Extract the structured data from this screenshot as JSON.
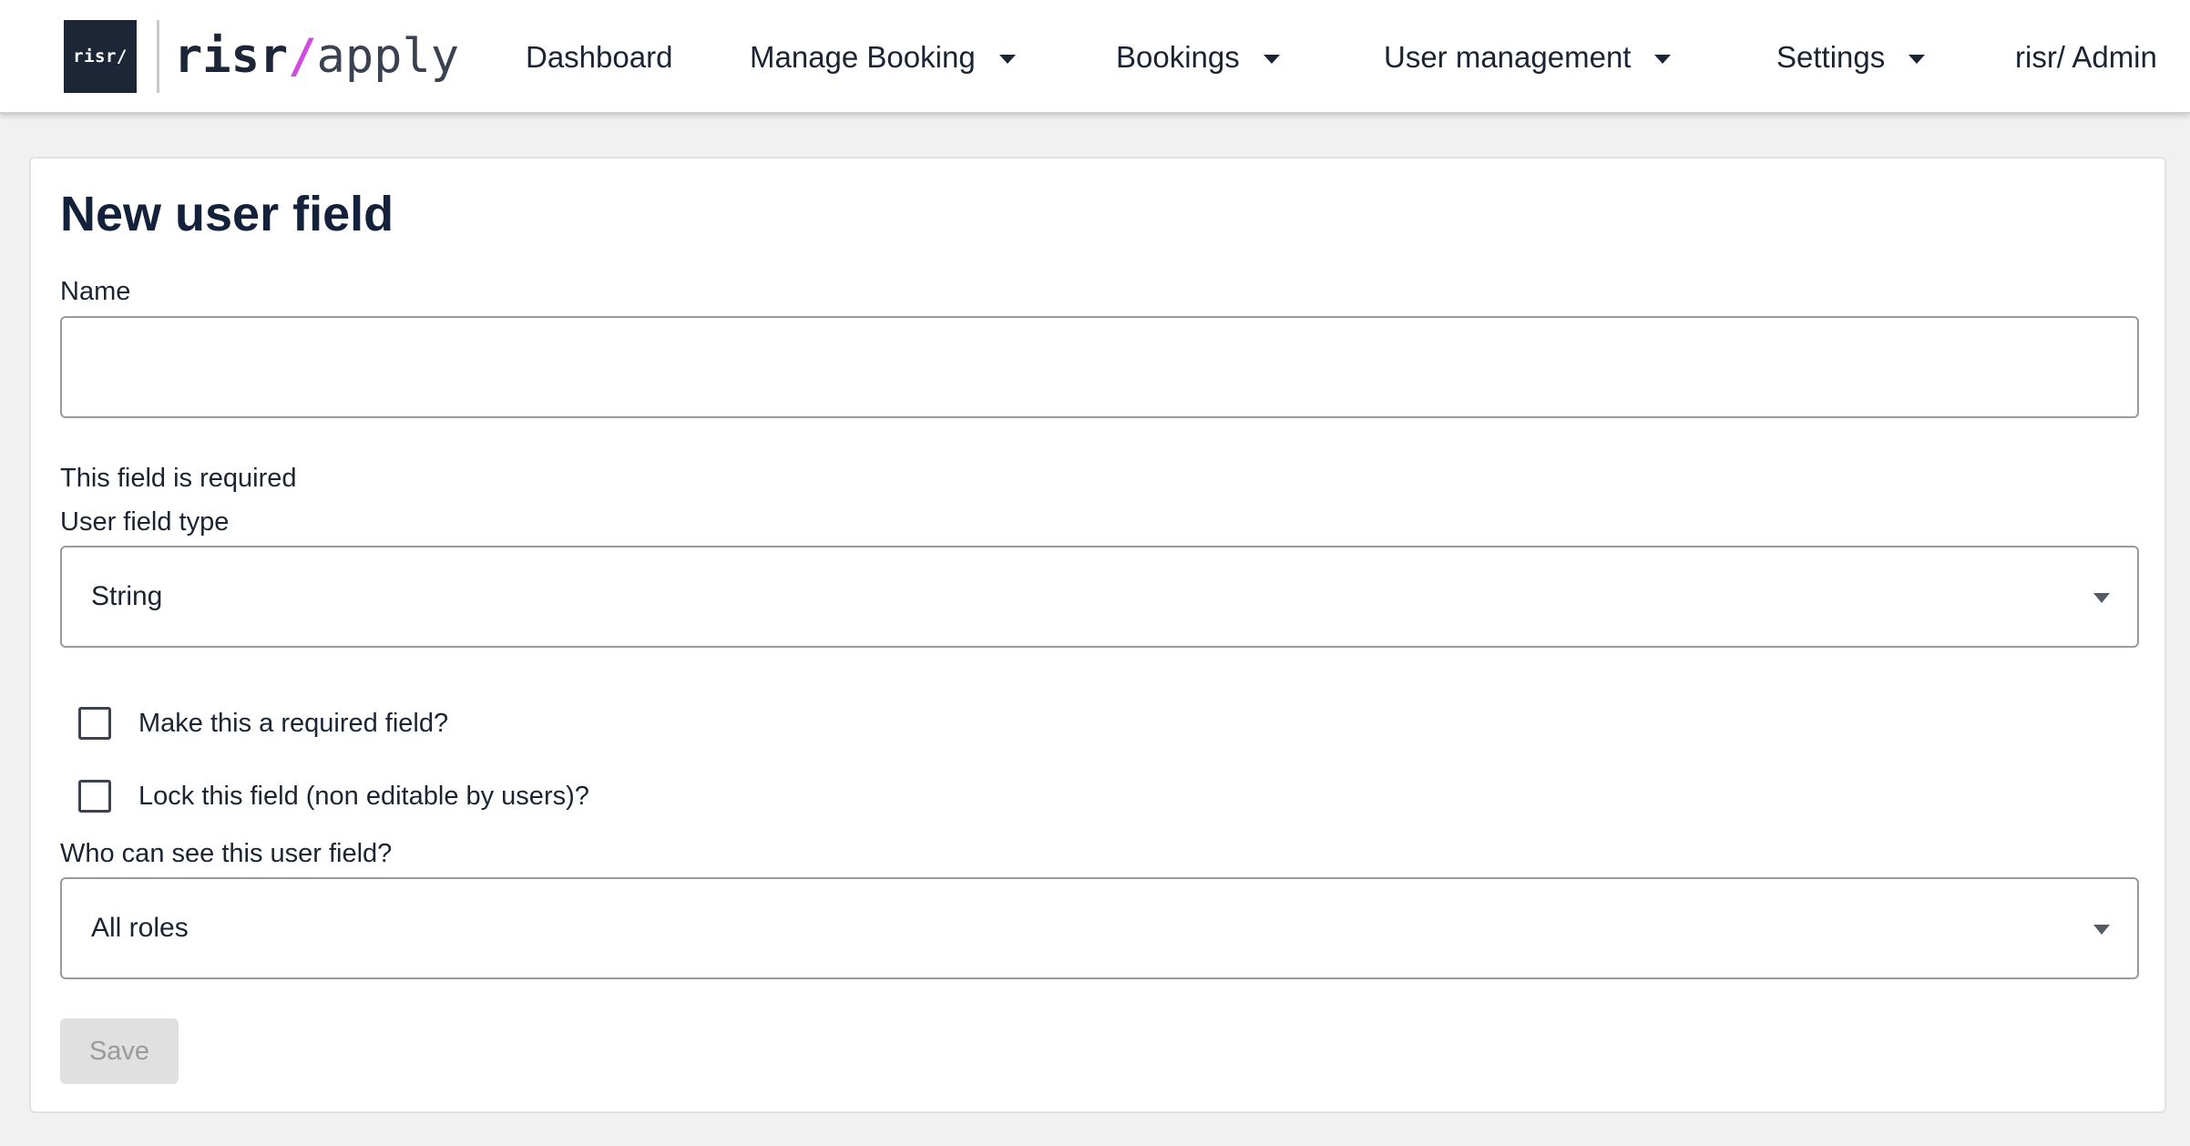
{
  "header": {
    "logo": {
      "mark": "risr/",
      "brand": "risr",
      "slash": "/",
      "sub": "apply"
    },
    "nav": {
      "dashboard": "Dashboard",
      "manage_booking": "Manage Booking",
      "bookings": "Bookings",
      "user_management": "User management",
      "settings": "Settings",
      "account": "risr/ Admin"
    }
  },
  "form": {
    "title": "New user field",
    "name_label": "Name",
    "name_value": "",
    "name_error": "This field is required",
    "type_label": "User field type",
    "type_value": "String",
    "required_checkbox_label": "Make this a required field?",
    "lock_checkbox_label": "Lock this field (non editable by users)?",
    "visibility_label": "Who can see this user field?",
    "visibility_value": "All roles",
    "save_label": "Save"
  },
  "colors": {
    "brand_dark": "#1d2636",
    "brand_accent": "#d04bdf",
    "disabled_button_bg": "#e0e0e0",
    "disabled_button_text": "#9a9a9a"
  }
}
